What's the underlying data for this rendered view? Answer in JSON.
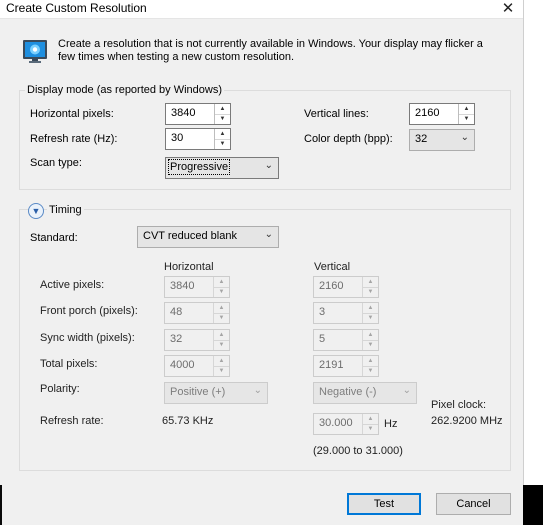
{
  "window": {
    "title": "Create Custom Resolution",
    "close_glyph": "✕"
  },
  "info": {
    "icon": "monitor-icon",
    "text": "Create a resolution that is not currently available in Windows. Your display may flicker a few times when testing a new custom resolution."
  },
  "display_mode": {
    "title": "Display mode (as reported by Windows)",
    "horizontal_pixels_label": "Horizontal pixels:",
    "horizontal_pixels_value": "3840",
    "vertical_lines_label": "Vertical lines:",
    "vertical_lines_value": "2160",
    "refresh_rate_label": "Refresh rate (Hz):",
    "refresh_rate_value": "30",
    "color_depth_label": "Color depth (bpp):",
    "color_depth_value": "32",
    "scan_type_label": "Scan type:",
    "scan_type_value": "Progressive"
  },
  "timing": {
    "title": "Timing",
    "standard_label": "Standard:",
    "standard_value": "CVT reduced blank",
    "col_horizontal": "Horizontal",
    "col_vertical": "Vertical",
    "active_label": "Active pixels:",
    "active_h": "3840",
    "active_v": "2160",
    "front_porch_label": "Front porch (pixels):",
    "front_porch_h": "48",
    "front_porch_v": "3",
    "sync_width_label": "Sync width (pixels):",
    "sync_width_h": "32",
    "sync_width_v": "5",
    "total_label": "Total pixels:",
    "total_h": "4000",
    "total_v": "2191",
    "polarity_label": "Polarity:",
    "polarity_h": "Positive (+)",
    "polarity_v": "Negative (-)",
    "refresh_label": "Refresh rate:",
    "refresh_h": "65.73 KHz",
    "refresh_v": "30.000",
    "refresh_unit": "Hz",
    "refresh_range": "(29.000 to 31.000)",
    "pixel_clock_label": "Pixel clock:",
    "pixel_clock_value": "262.9200 MHz"
  },
  "buttons": {
    "test": "Test",
    "cancel": "Cancel"
  }
}
